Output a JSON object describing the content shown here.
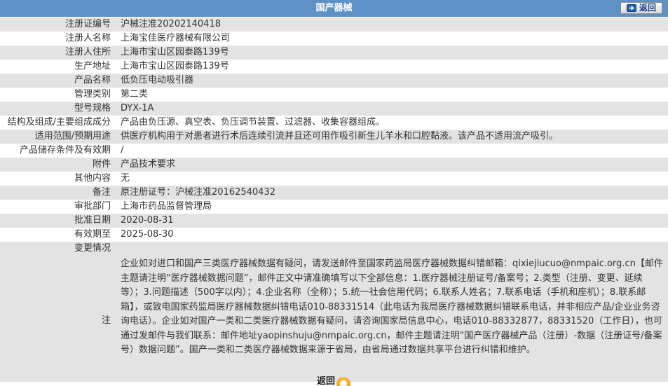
{
  "header": {
    "title": "国产器械",
    "back_label": "返回"
  },
  "rows": [
    {
      "label": "注册证编号",
      "value": "沪械注准20202140418"
    },
    {
      "label": "注册人名称",
      "value": "上海宝佳医疗器械有限公司"
    },
    {
      "label": "注册人住所",
      "value": "上海市宝山区园泰路139号"
    },
    {
      "label": "生产地址",
      "value": "上海市宝山区园泰路139号"
    },
    {
      "label": "产品名称",
      "value": "低负压电动吸引器"
    },
    {
      "label": "管理类别",
      "value": "第二类"
    },
    {
      "label": "型号规格",
      "value": "DYX-1A"
    },
    {
      "label": "结构及组成/主要组成成分",
      "value": "产品由负压源、真空表、负压调节装置、过滤器、收集容器组成。"
    },
    {
      "label": "适用范围/预期用途",
      "value": "供医疗机构用于对患者进行术后连续引流并且还可用作吸引新生儿羊水和口腔黏液。该产品不适用流产吸引。"
    },
    {
      "label": "产品储存条件及有效期",
      "value": "/"
    },
    {
      "label": "附件",
      "value": "产品技术要求"
    },
    {
      "label": "其他内容",
      "value": "无"
    },
    {
      "label": "备注",
      "value": "原注册证号：沪械注准20162540432"
    },
    {
      "label": "审批部门",
      "value": "上海市药品监督管理局"
    },
    {
      "label": "批准日期",
      "value": "2020-08-31"
    },
    {
      "label": "有效期至",
      "value": "2025-08-30"
    },
    {
      "label": "变更情况",
      "value": ""
    }
  ],
  "note": {
    "label": "注",
    "text": "企业如对进口和国产三类医疗器械数据有疑问，请发送邮件至国家药监局医疗器械数据纠错邮箱：qixiejiucuo@nmpaic.org.cn【邮件主题请注明“医疗器械数据问题”，邮件正文中请准确填写以下全部信息：1.医疗器械注册证号/备案号；2.类型（注册、变更、延续等）；3.问题描述（500字以内）；4.企业名称（全称）；5.统一社会信用代码；6.联系人姓名；7.联系电话（手机和座机）；8.联系邮箱】，或致电国家药监局医疗器械数据纠错电话010-88331514（此电话为我局医疗器械数据纠错联系电话，并非相应产品/企业业务咨询电话）。企业如对国产一类和二类医疗器械数据有疑问，请咨询国家局信息中心，电话010-88332877，88331520（工作日），也可通过发邮件与我们联系：邮件地址yaopinshuju@nmpaic.org.cn，邮件主题请注明“国产医疗器械产品（注册）-数据（注册证号/备案号）数据问题”。国产一类和二类医疗器械数据来源于省局，由省局通过数据共享平台进行纠错和维护。"
  },
  "footer": {
    "back_label": "返回"
  }
}
